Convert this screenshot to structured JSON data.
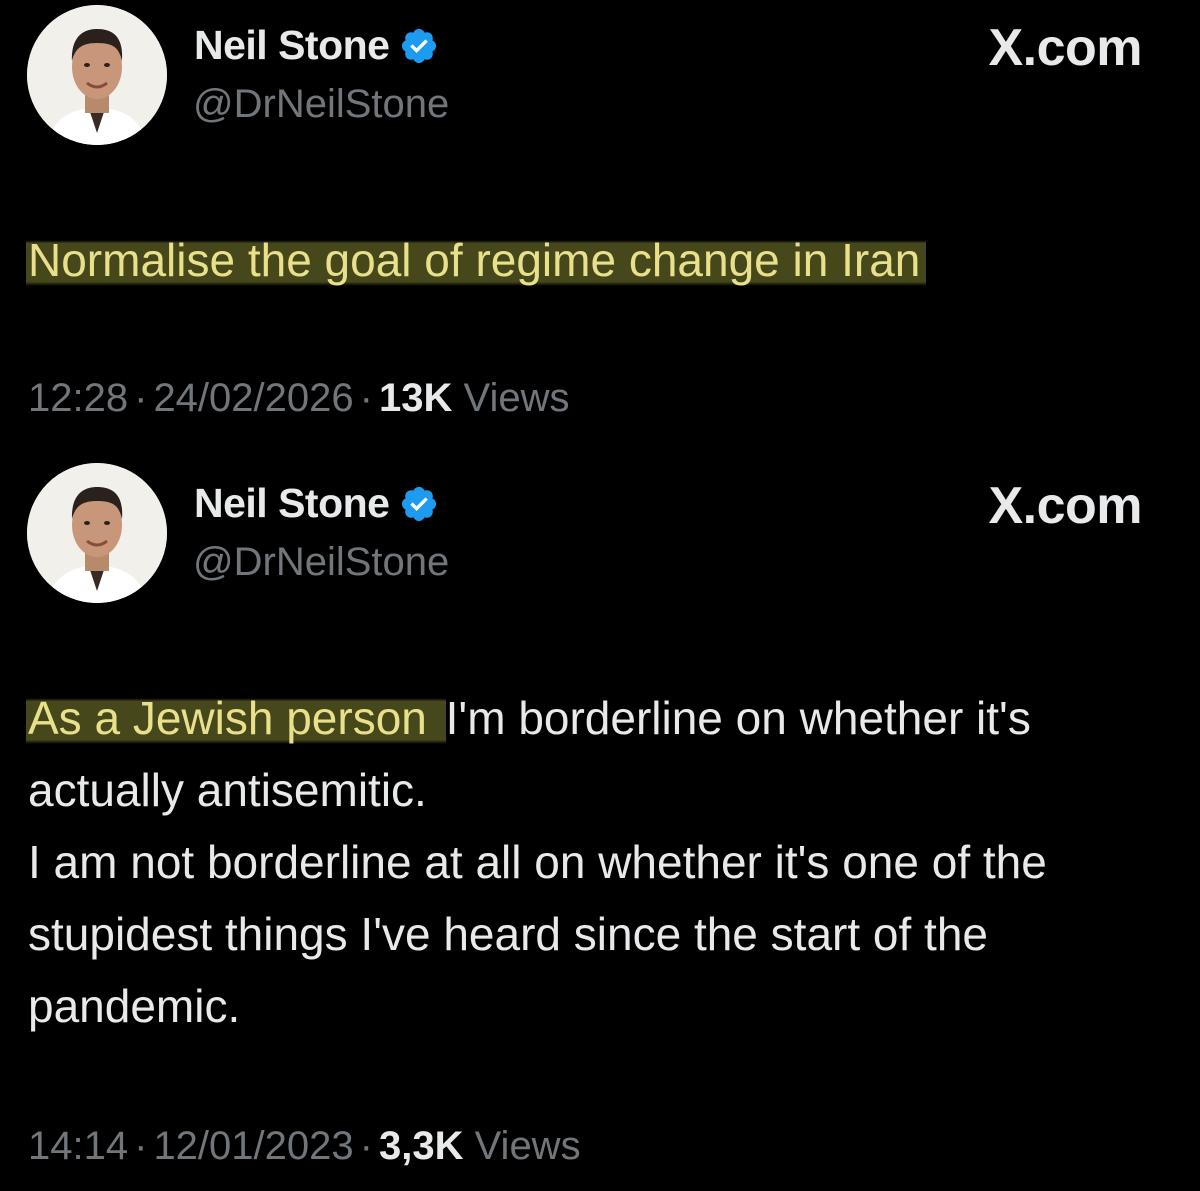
{
  "tweets": [
    {
      "author_name": "Neil Stone",
      "handle": "@DrNeilStone",
      "site": "X.com",
      "text_highlighted": "Normalise the goal of regime change in Iran",
      "text_rest": "",
      "time": "12:28",
      "date": "24/02/2026",
      "views_count": "13K",
      "views_label": "Views"
    },
    {
      "author_name": "Neil Stone",
      "handle": "@DrNeilStone",
      "site": "X.com",
      "text_highlighted": "As a Jewish person ",
      "text_rest": "I'm borderline on whether it's actually antisemitic.\nI am not borderline at all on whether it's one of the stupidest things I've heard since the start of the pandemic.",
      "time": "14:14",
      "date": "12/01/2023",
      "views_count": "3,3K",
      "views_label": "Views"
    }
  ],
  "icons": {
    "verified": "verified-badge-icon",
    "avatar": "profile-photo"
  },
  "colors": {
    "background": "#000000",
    "text": "#e7e9ea",
    "muted": "#71767b",
    "verified": "#1d9bf0",
    "highlight_text": "#e8e08a",
    "highlight_bg": "#5f5f26"
  }
}
